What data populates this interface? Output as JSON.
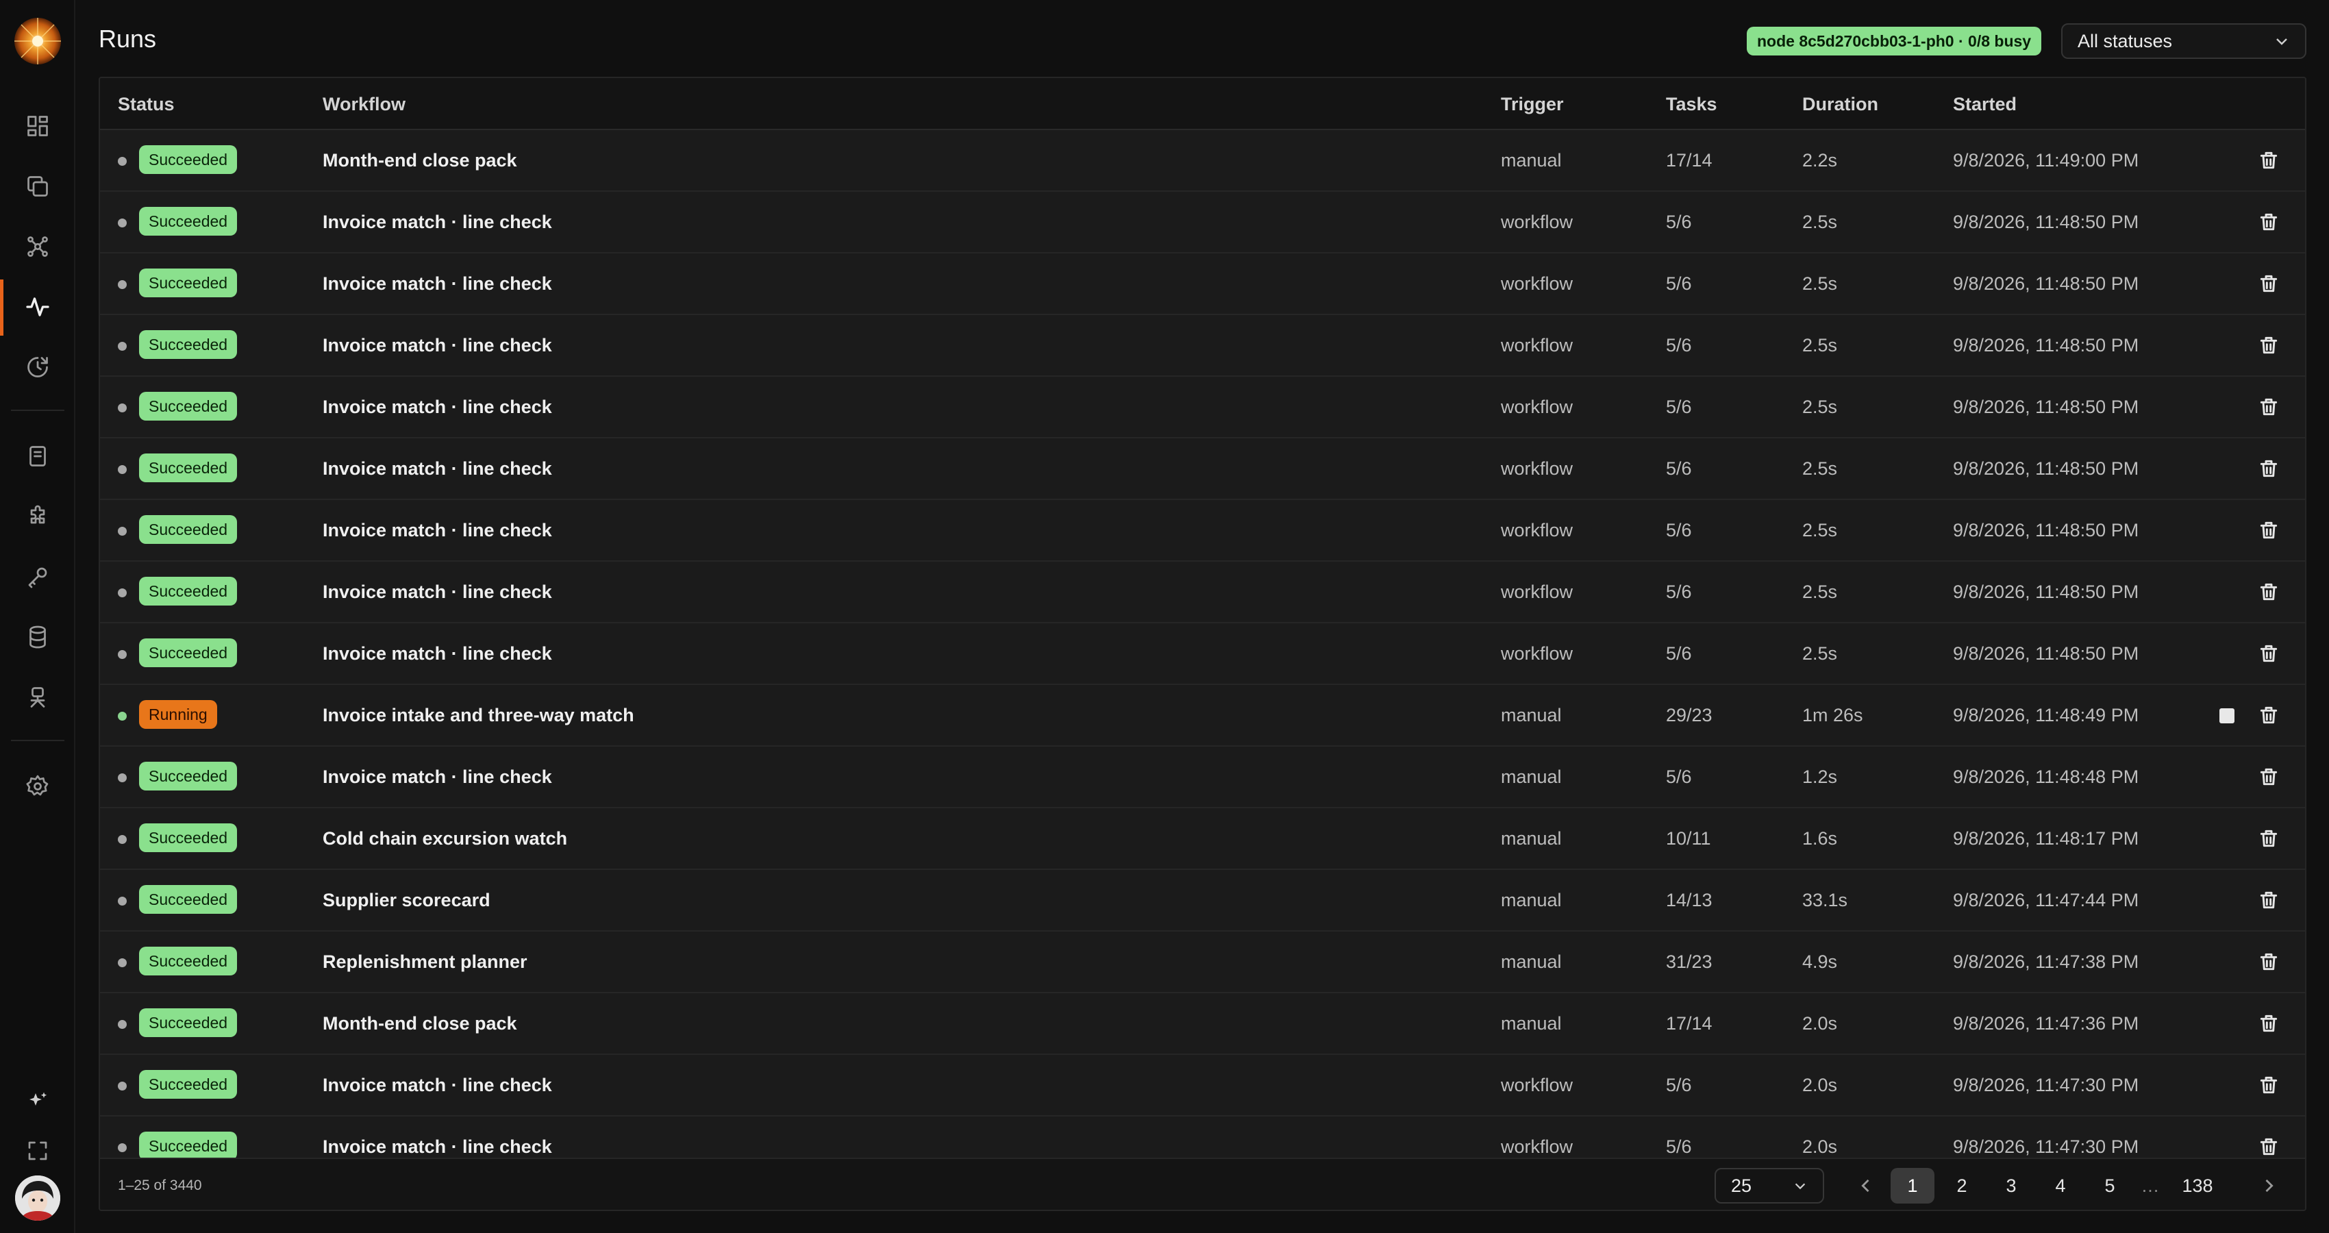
{
  "app": {
    "page_title": "Runs"
  },
  "sidebar": {
    "items": [
      {
        "icon": "dashboard-icon"
      },
      {
        "icon": "workflows-icon"
      },
      {
        "icon": "network-icon"
      },
      {
        "icon": "activity-icon",
        "active": true
      },
      {
        "icon": "schedule-icon"
      },
      {
        "icon": "book-icon"
      },
      {
        "icon": "puzzle-icon"
      },
      {
        "icon": "key-icon"
      },
      {
        "icon": "database-icon"
      },
      {
        "icon": "agent-icon"
      },
      {
        "icon": "gear-icon"
      }
    ],
    "bottom": [
      {
        "icon": "sparkle-icon"
      },
      {
        "icon": "fullscreen-icon"
      },
      {
        "icon": "avatar"
      }
    ],
    "accent": "#e8631a"
  },
  "header": {
    "node_badge": "node 8c5d270cbb03-1-ph0 · 0/8 busy",
    "status_filter": "All statuses"
  },
  "table": {
    "columns": [
      "Status",
      "Workflow",
      "Trigger",
      "Tasks",
      "Duration",
      "Started"
    ],
    "rows": [
      {
        "status": "Succeeded",
        "workflow": "Month-end close pack",
        "trigger": "manual",
        "tasks": "17/14",
        "duration": "2.2s",
        "started": "9/8/2026, 11:49:00 PM"
      },
      {
        "status": "Succeeded",
        "workflow": "Invoice match · line check",
        "trigger": "workflow",
        "tasks": "5/6",
        "duration": "2.5s",
        "started": "9/8/2026, 11:48:50 PM"
      },
      {
        "status": "Succeeded",
        "workflow": "Invoice match · line check",
        "trigger": "workflow",
        "tasks": "5/6",
        "duration": "2.5s",
        "started": "9/8/2026, 11:48:50 PM"
      },
      {
        "status": "Succeeded",
        "workflow": "Invoice match · line check",
        "trigger": "workflow",
        "tasks": "5/6",
        "duration": "2.5s",
        "started": "9/8/2026, 11:48:50 PM"
      },
      {
        "status": "Succeeded",
        "workflow": "Invoice match · line check",
        "trigger": "workflow",
        "tasks": "5/6",
        "duration": "2.5s",
        "started": "9/8/2026, 11:48:50 PM"
      },
      {
        "status": "Succeeded",
        "workflow": "Invoice match · line check",
        "trigger": "workflow",
        "tasks": "5/6",
        "duration": "2.5s",
        "started": "9/8/2026, 11:48:50 PM"
      },
      {
        "status": "Succeeded",
        "workflow": "Invoice match · line check",
        "trigger": "workflow",
        "tasks": "5/6",
        "duration": "2.5s",
        "started": "9/8/2026, 11:48:50 PM"
      },
      {
        "status": "Succeeded",
        "workflow": "Invoice match · line check",
        "trigger": "workflow",
        "tasks": "5/6",
        "duration": "2.5s",
        "started": "9/8/2026, 11:48:50 PM"
      },
      {
        "status": "Succeeded",
        "workflow": "Invoice match · line check",
        "trigger": "workflow",
        "tasks": "5/6",
        "duration": "2.5s",
        "started": "9/8/2026, 11:48:50 PM"
      },
      {
        "status": "Running",
        "workflow": "Invoice intake and three-way match",
        "trigger": "manual",
        "tasks": "29/23",
        "duration": "1m 26s",
        "started": "9/8/2026, 11:48:49 PM",
        "stoppable": true
      },
      {
        "status": "Succeeded",
        "workflow": "Invoice match · line check",
        "trigger": "manual",
        "tasks": "5/6",
        "duration": "1.2s",
        "started": "9/8/2026, 11:48:48 PM"
      },
      {
        "status": "Succeeded",
        "workflow": "Cold chain excursion watch",
        "trigger": "manual",
        "tasks": "10/11",
        "duration": "1.6s",
        "started": "9/8/2026, 11:48:17 PM"
      },
      {
        "status": "Succeeded",
        "workflow": "Supplier scorecard",
        "trigger": "manual",
        "tasks": "14/13",
        "duration": "33.1s",
        "started": "9/8/2026, 11:47:44 PM"
      },
      {
        "status": "Succeeded",
        "workflow": "Replenishment planner",
        "trigger": "manual",
        "tasks": "31/23",
        "duration": "4.9s",
        "started": "9/8/2026, 11:47:38 PM"
      },
      {
        "status": "Succeeded",
        "workflow": "Month-end close pack",
        "trigger": "manual",
        "tasks": "17/14",
        "duration": "2.0s",
        "started": "9/8/2026, 11:47:36 PM"
      },
      {
        "status": "Succeeded",
        "workflow": "Invoice match · line check",
        "trigger": "workflow",
        "tasks": "5/6",
        "duration": "2.0s",
        "started": "9/8/2026, 11:47:30 PM"
      },
      {
        "status": "Succeeded",
        "workflow": "Invoice match · line check",
        "trigger": "workflow",
        "tasks": "5/6",
        "duration": "2.0s",
        "started": "9/8/2026, 11:47:30 PM"
      }
    ]
  },
  "footer": {
    "range": "1–25 of 3440",
    "page_size": "25",
    "pages": [
      "1",
      "2",
      "3",
      "4",
      "5",
      "…",
      "138"
    ],
    "current_page": "1"
  },
  "colors": {
    "succeeded": "#8ae08d",
    "running": "#e8761a",
    "background": "#101010"
  }
}
